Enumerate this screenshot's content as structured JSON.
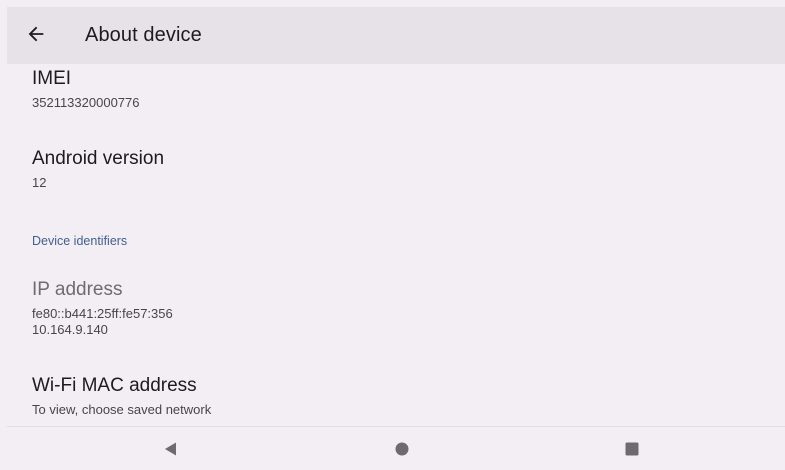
{
  "header": {
    "title": "About device",
    "back_icon": "arrow-back-icon"
  },
  "items": [
    {
      "title": "IMEI",
      "summary": "352113320000776"
    },
    {
      "title": "Android version",
      "summary": "12"
    }
  ],
  "category": {
    "label": "Device identifiers"
  },
  "ip_item": {
    "title": "IP address",
    "summary_line1": "fe80::b441:25ff:fe57:356",
    "summary_line2": "10.164.9.140"
  },
  "wifi_item": {
    "title": "Wi-Fi MAC address",
    "summary": "To view, choose saved network"
  },
  "navigation": {
    "back_icon": "triangle-back-icon",
    "home_icon": "circle-home-icon",
    "recents_icon": "square-recents-icon"
  },
  "colors": {
    "background": "#f3eef4",
    "app_bar": "#e7e2e8",
    "accent": "#41608f"
  }
}
